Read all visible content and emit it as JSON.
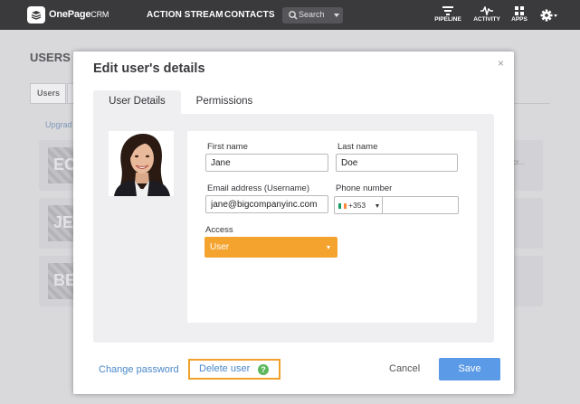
{
  "app": {
    "logo_bold": "OnePage",
    "logo_light": "CRM"
  },
  "topnav": {
    "action_stream": "ACTION STREAM",
    "contacts": "CONTACTS",
    "search_placeholder": "Search",
    "pipeline": "PIPELINE",
    "activity": "ACTIVITY",
    "apps": "APPS"
  },
  "background": {
    "page_title": "USERS",
    "tab_users": "Users",
    "upgrade_link": "Upgrad",
    "cards": [
      {
        "initials": "EO"
      },
      {
        "initials": "JE"
      },
      {
        "initials": "BE"
      }
    ],
    "overflow_text": "cr..."
  },
  "modal": {
    "title": "Edit user's details",
    "close": "×",
    "tabs": [
      {
        "label": "User Details",
        "active": true
      },
      {
        "label": "Permissions",
        "active": false
      }
    ],
    "form": {
      "first_name_label": "First name",
      "first_name_value": "Jane",
      "last_name_label": "Last name",
      "last_name_value": "Doe",
      "email_label": "Email address (Username)",
      "email_value": "jane@bigcompanyinc.com",
      "phone_label": "Phone number",
      "phone_prefix": "+353",
      "phone_value": "",
      "access_label": "Access",
      "access_value": "User"
    },
    "footer": {
      "change_password": "Change password",
      "delete_user": "Delete user",
      "help": "?",
      "cancel": "Cancel",
      "save": "Save"
    }
  },
  "colors": {
    "topbar": "#3a3a3c",
    "accent_orange": "#f4a42e",
    "link_blue": "#4a88c8",
    "save_blue": "#5a9ae6",
    "help_green": "#5cb85c"
  },
  "icons": [
    "logo-icon",
    "search-icon",
    "pipeline-icon",
    "activity-icon",
    "apps-icon",
    "gear-icon",
    "close-icon",
    "help-icon",
    "chevron-down-icon"
  ]
}
